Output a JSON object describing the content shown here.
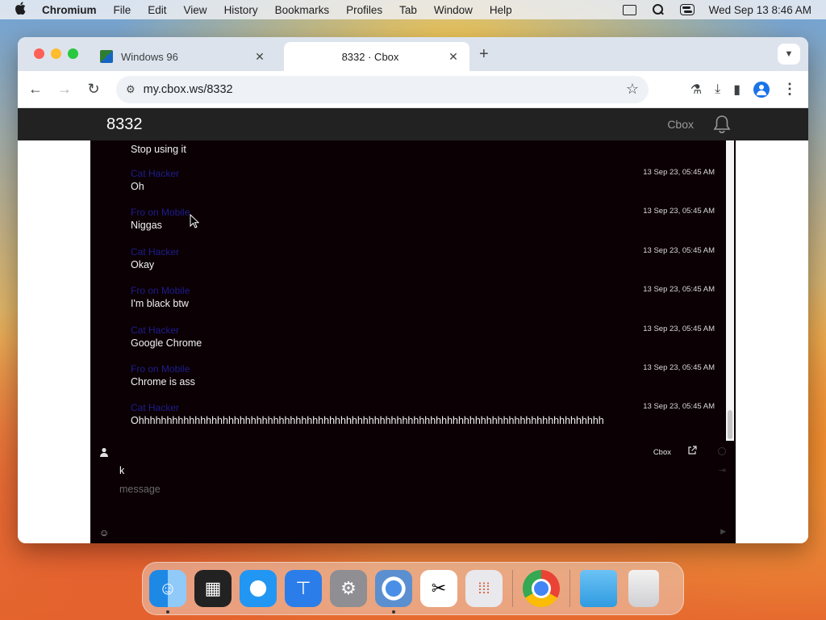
{
  "menubar": {
    "app_name": "Chromium",
    "items": [
      "File",
      "Edit",
      "View",
      "History",
      "Bookmarks",
      "Profiles",
      "Tab",
      "Window",
      "Help"
    ],
    "datetime": "Wed Sep 13  8:46 AM"
  },
  "browser": {
    "tabs": [
      {
        "title": "Windows 96",
        "active": false
      },
      {
        "title": "8332 · Cbox",
        "active": true
      }
    ],
    "url": "my.cbox.ws/8332"
  },
  "site": {
    "room": "8332",
    "brand": "Cbox"
  },
  "chat": {
    "messages": [
      {
        "name": "",
        "time": "",
        "text": "Stop using it"
      },
      {
        "name": "Cat Hacker",
        "time": "13 Sep 23, 05:45 AM",
        "text": "Oh"
      },
      {
        "name": "Fro on Mobile",
        "time": "13 Sep 23, 05:45 AM",
        "text": "Niggas"
      },
      {
        "name": "Cat Hacker",
        "time": "13 Sep 23, 05:45 AM",
        "text": "Okay"
      },
      {
        "name": "Fro on Mobile",
        "time": "13 Sep 23, 05:45 AM",
        "text": "I'm black btw"
      },
      {
        "name": "Cat Hacker",
        "time": "13 Sep 23, 05:45 AM",
        "text": "Google Chrome"
      },
      {
        "name": "Fro on Mobile",
        "time": "13 Sep 23, 05:45 AM",
        "text": "Chrome is ass"
      },
      {
        "name": "Cat Hacker",
        "time": "13 Sep 23, 05:45 AM",
        "text": "Ohhhhhhhhhhhhhhhhhhhhhhhhhhhhhhhhhhhhhhhhhhhhhhhhhhhhhhhhhhhhhhhhhhhhhhhhhhhhhhhhhhh"
      }
    ],
    "composer": {
      "brand_link": "Cbox",
      "name_value": "k",
      "message_placeholder": "message"
    }
  },
  "colors": {
    "chat_background": "#0b0004",
    "username": "#1d1d8e",
    "header": "#222222"
  },
  "dock": [
    "Finder",
    "Mission Control",
    "Safari",
    "Keynote",
    "System Settings",
    "Chromium",
    "CapCut",
    "Launchpad",
    "Google Chrome",
    "Downloads",
    "Trash"
  ]
}
